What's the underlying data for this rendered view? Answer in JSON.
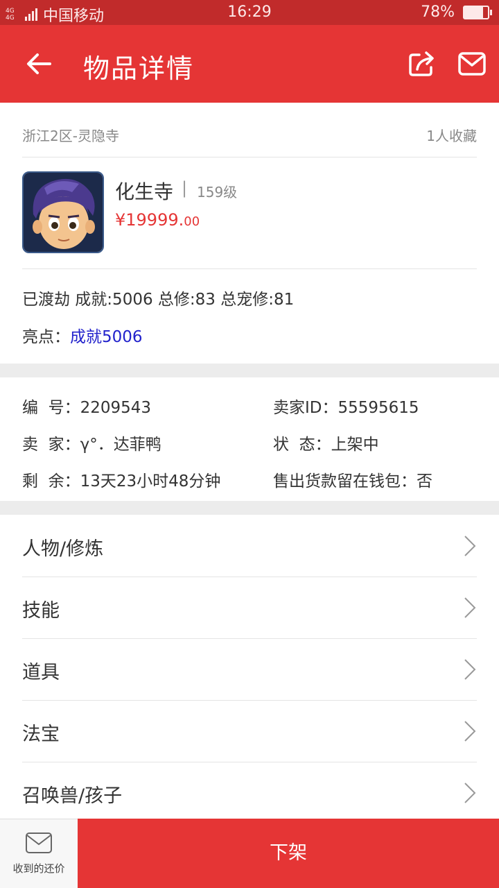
{
  "status_bar": {
    "network": "4G 4G",
    "carrier": "中国移动",
    "time": "16:29",
    "battery_percent": "78%",
    "battery_level": 0.78
  },
  "header": {
    "title": "物品详情",
    "back_icon": "arrow-left-icon",
    "share_icon": "share-icon",
    "message_icon": "mail-icon",
    "background": "#e53535"
  },
  "item": {
    "region": "浙江2区-灵隐寺",
    "favorites": "1人收藏",
    "role_name": "化生寺",
    "separator": "|",
    "level": "159级",
    "price_main": "¥19999.",
    "price_decimal": "00",
    "price_color": "#e53535",
    "description": "已渡劫 成就:5006 总修:83 总宠修:81",
    "highlight_label": "亮点：",
    "highlight_value": "成就5006"
  },
  "info": {
    "id_label": "编  号：",
    "id_value": "2209543",
    "seller_id_label": "卖家ID：",
    "seller_id_value": "55595615",
    "seller_label": "卖  家：",
    "seller_value": "γ°．达菲鸭",
    "state_label": "状  态：",
    "state_value": "上架中",
    "remaining_label": "剩  余：",
    "remaining_value": "13天23小时48分钟",
    "wallet_label": "售出货款留在钱包：",
    "wallet_value": "否"
  },
  "menu": [
    {
      "label": "人物/修炼"
    },
    {
      "label": "技能"
    },
    {
      "label": "道具"
    },
    {
      "label": "法宝"
    },
    {
      "label": "召唤兽/孩子"
    }
  ],
  "bottom": {
    "offers_label": "收到的还价",
    "offers_icon": "envelope-icon",
    "delist_label": "下架"
  }
}
